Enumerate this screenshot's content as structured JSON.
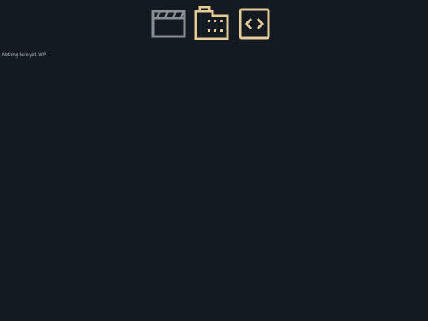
{
  "nav": {
    "items": [
      {
        "id": "clips",
        "icon": "clapperboard-icon",
        "color": "#8a8d92",
        "active": false
      },
      {
        "id": "files",
        "icon": "film-folder-icon",
        "color": "#e6cc99",
        "active": true
      },
      {
        "id": "code",
        "icon": "code-icon",
        "color": "#e6cc99",
        "active": false
      }
    ]
  },
  "main": {
    "status_text": "Nothing here yet. WIP"
  },
  "colors": {
    "background": "#141a21",
    "accent": "#e6cc99",
    "muted": "#8a8d92",
    "text": "#b8bcc2"
  }
}
